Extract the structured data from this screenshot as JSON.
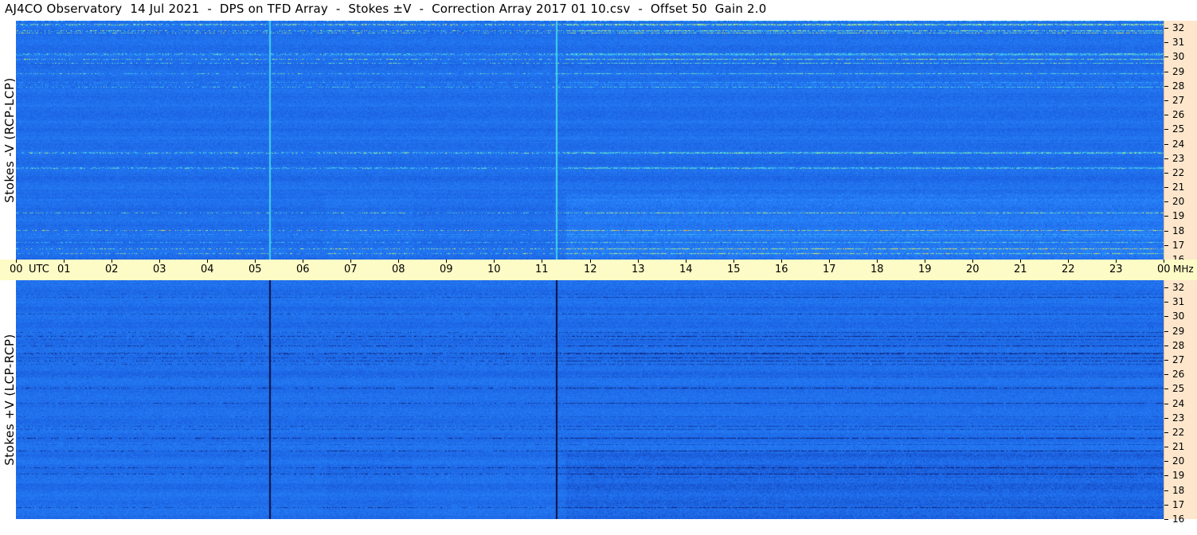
{
  "title": "AJ4CO Observatory  14 Jul 2021  -  DPS on TFD Array  -  Stokes ±V  -  Correction Array 2017 01 10.csv  -  Offset 50  Gain 2.0",
  "chart_data": [
    {
      "type": "heatmap",
      "ylabel": "Stokes -V (RCP-LCP)",
      "xlabel": "UTC",
      "x_ticks": [
        "00",
        "01",
        "02",
        "03",
        "04",
        "05",
        "06",
        "07",
        "08",
        "09",
        "10",
        "11",
        "12",
        "13",
        "14",
        "15",
        "16",
        "17",
        "18",
        "19",
        "20",
        "21",
        "22",
        "23",
        "00"
      ],
      "y_unit": "MHz",
      "y_ticks": [
        16,
        17,
        18,
        19,
        20,
        21,
        22,
        23,
        24,
        25,
        26,
        27,
        28,
        29,
        30,
        31,
        32
      ],
      "xlim": [
        0,
        24
      ],
      "ylim": [
        16,
        32.5
      ],
      "colormap": [
        "#0d1b6b",
        "#1a5fe0",
        "#2b8bff",
        "#3fd2e8",
        "#f5f54a",
        "#ff4d2e"
      ],
      "vertical_lines_utc": [
        5.3,
        11.3
      ],
      "vertical_line_color": "#3fd2e8"
    },
    {
      "type": "heatmap",
      "ylabel": "Stokes +V (LCP-RCP)",
      "xlabel": "UTC",
      "x_ticks": [
        "00",
        "01",
        "02",
        "03",
        "04",
        "05",
        "06",
        "07",
        "08",
        "09",
        "10",
        "11",
        "12",
        "13",
        "14",
        "15",
        "16",
        "17",
        "18",
        "19",
        "20",
        "21",
        "22",
        "23",
        "00"
      ],
      "y_unit": "MHz",
      "y_ticks": [
        16,
        17,
        18,
        19,
        20,
        21,
        22,
        23,
        24,
        25,
        26,
        27,
        28,
        29,
        30,
        31,
        32
      ],
      "xlim": [
        0,
        24
      ],
      "ylim": [
        16,
        32.5
      ],
      "colormap": [
        "#0d1b6b",
        "#1a5fe0",
        "#2b8bff",
        "#3fd2e8",
        "#f5f54a",
        "#ff4d2e"
      ],
      "vertical_lines_utc": [
        5.3,
        11.3
      ],
      "vertical_line_color": "#0a0f40"
    }
  ],
  "time_axis": {
    "utc_label": "UTC",
    "mhz_label": "MHz"
  }
}
